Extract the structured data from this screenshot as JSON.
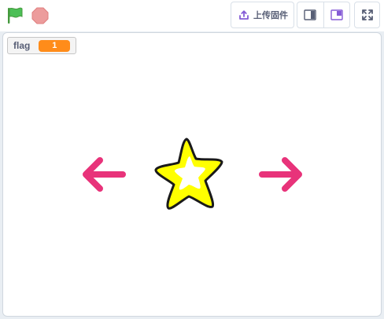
{
  "toolbar": {
    "green_flag_icon": "green-flag-icon",
    "stop_icon": "stop-icon",
    "upload_label": "上传固件",
    "upload_icon": "upload-icon",
    "small_stage_icon": "small-stage-icon",
    "large_stage_icon": "large-stage-icon",
    "fullscreen_icon": "fullscreen-icon"
  },
  "stage": {
    "monitor": {
      "label": "flag",
      "value": "1"
    },
    "sprites": [
      "left-arrow",
      "star",
      "right-arrow"
    ]
  },
  "colors": {
    "flag_green": "#4cbf56",
    "stop_red": "#ec9c9c",
    "accent_purple": "#855cd6",
    "monitor_orange": "#ff8c1a",
    "arrow_pink": "#e8337a",
    "star_yellow": "#ffff00"
  }
}
